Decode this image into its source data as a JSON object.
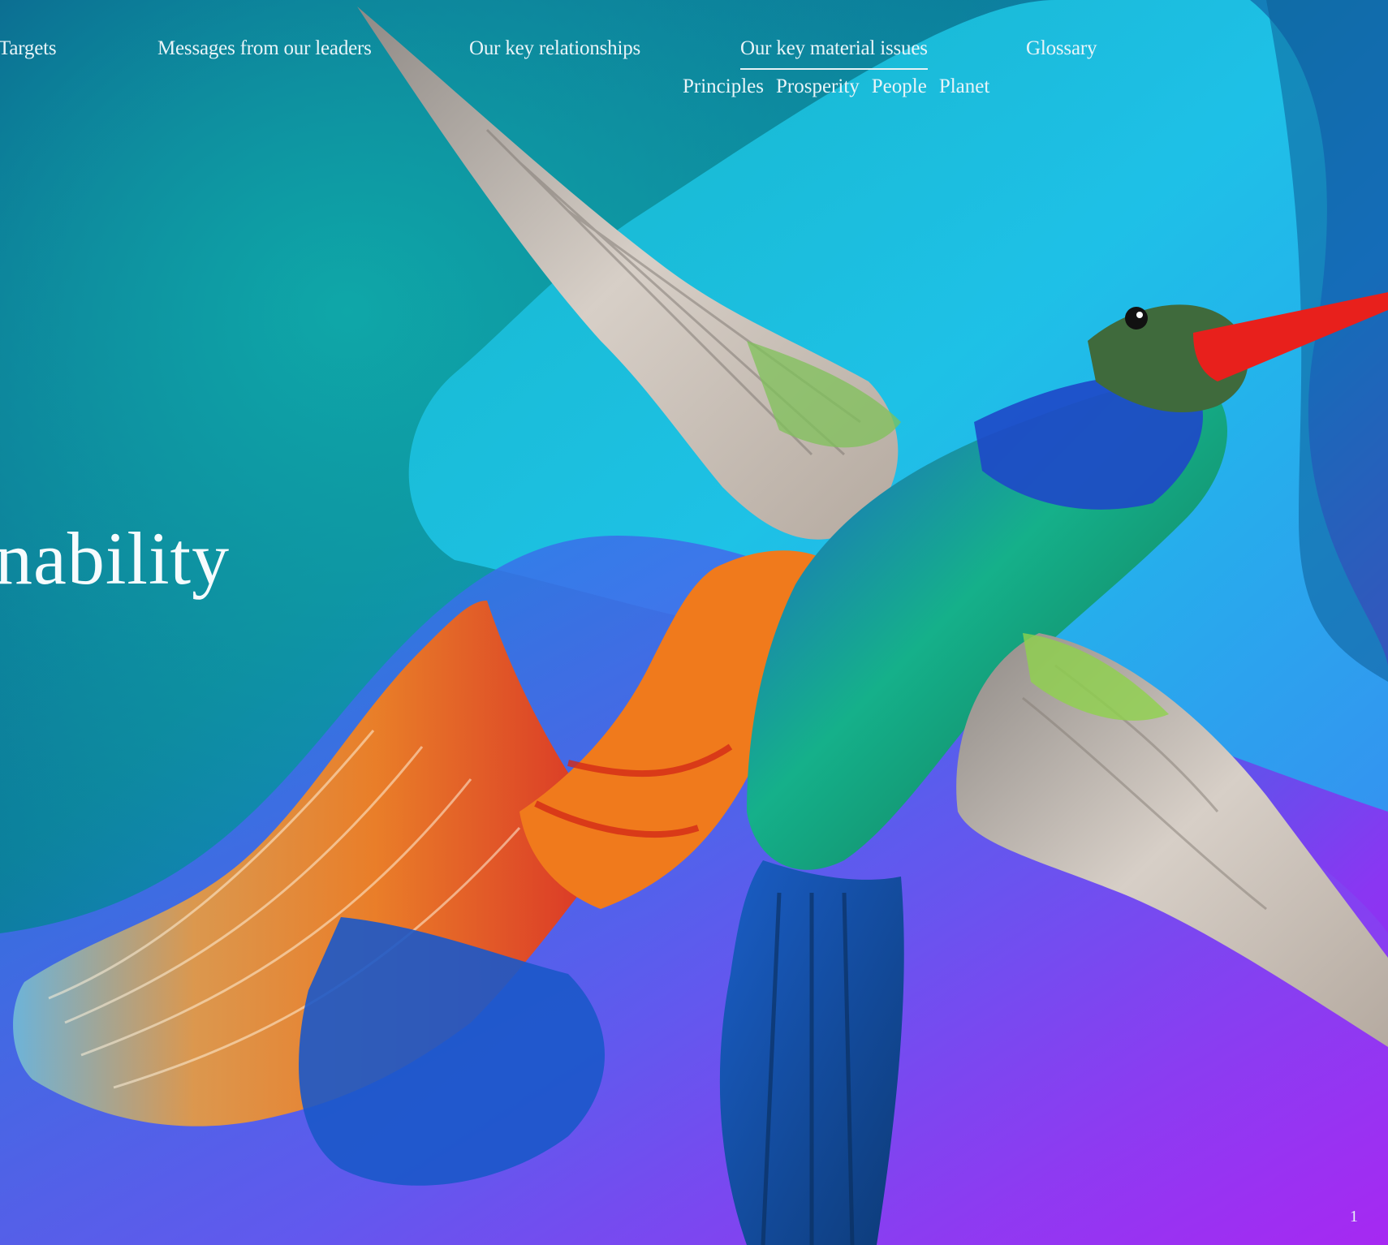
{
  "nav": {
    "items": [
      {
        "label": "Targets"
      },
      {
        "label": "Messages from our leaders"
      },
      {
        "label": "Our key relationships"
      },
      {
        "label": "Our key material issues",
        "active": true
      },
      {
        "label": "Glossary"
      }
    ],
    "subnav": [
      "Principles",
      "Prosperity",
      "People",
      "Planet"
    ]
  },
  "hero": {
    "headline": "nability"
  },
  "footer": {
    "page_number": "1"
  },
  "colors": {
    "bg_deep_blue": "#0b5a8c",
    "bg_teal": "#11a3ab",
    "bg_cyan": "#19c6e0",
    "bg_violet": "#9a2cf0",
    "text": "#eef6f9",
    "beak_red": "#e8201c",
    "fin_orange": "#f07a1c"
  },
  "illustration": {
    "subject": "hummingbird-with-betta-fish-tail"
  }
}
